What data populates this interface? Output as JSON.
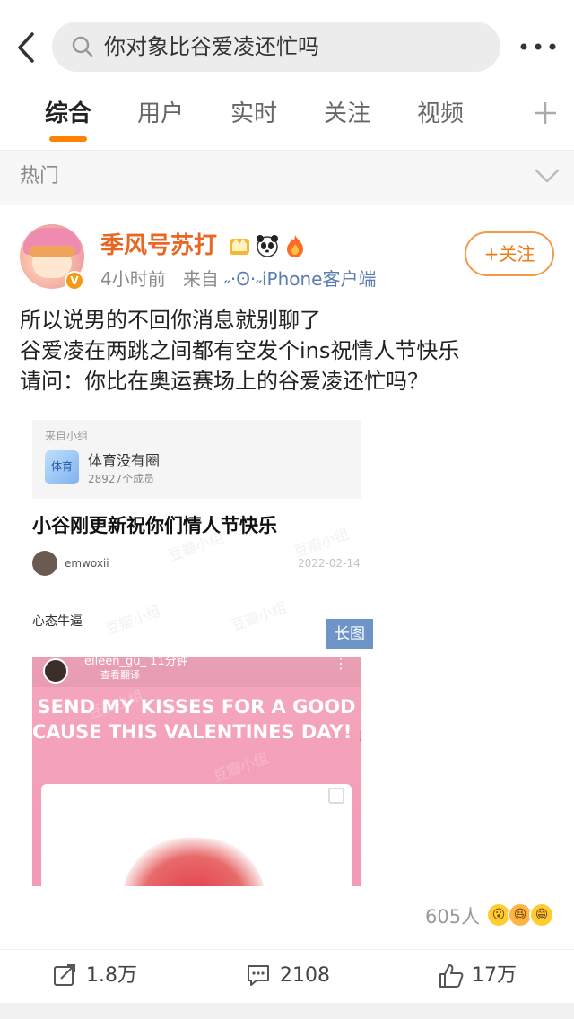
{
  "search": {
    "query": "你对象比谷爱凌还忙吗"
  },
  "tabs": [
    {
      "label": "综合"
    },
    {
      "label": "用户"
    },
    {
      "label": "实时"
    },
    {
      "label": "关注"
    },
    {
      "label": "视频"
    }
  ],
  "section": {
    "label": "热门"
  },
  "post": {
    "username": "季风号苏打",
    "time": "4小时前",
    "from_label": "来自",
    "source": "˶·ʘ·˶iPhone客户端",
    "follow_label": "+关注",
    "text_lines": [
      "所以说男的不回你消息就别聊了",
      "谷爱凌在两跳之间都有空发个ins祝情人节快乐",
      "请问：你比在奥运赛场上的谷爱凌还忙吗？"
    ],
    "card": {
      "from": "来自小组",
      "group_name": "体育没有圈",
      "group_icon_text": "体育",
      "members": "28927个成员",
      "title": "小谷刚更新祝你们情人节快乐",
      "author": "emwoxii",
      "date": "2022-02-14",
      "sub": "心态牛逼",
      "image": {
        "user": "eileen_gu_  11分钟",
        "translate": "查看翻译",
        "caption_lines": [
          "SEND MY KISSES FOR A GOOD",
          "CAUSE THIS VALENTINES DAY! 💋"
        ],
        "long_label": "长图"
      },
      "watermark": "豆瓣小组"
    },
    "reactions": {
      "count": "605人"
    },
    "actions": {
      "repost": "1.8万",
      "comment": "2108",
      "like": "17万"
    }
  },
  "colors": {
    "accent": "#ff8200",
    "username": "#e86722",
    "source": "#5b7cb0",
    "pink": "#f29ab6"
  }
}
